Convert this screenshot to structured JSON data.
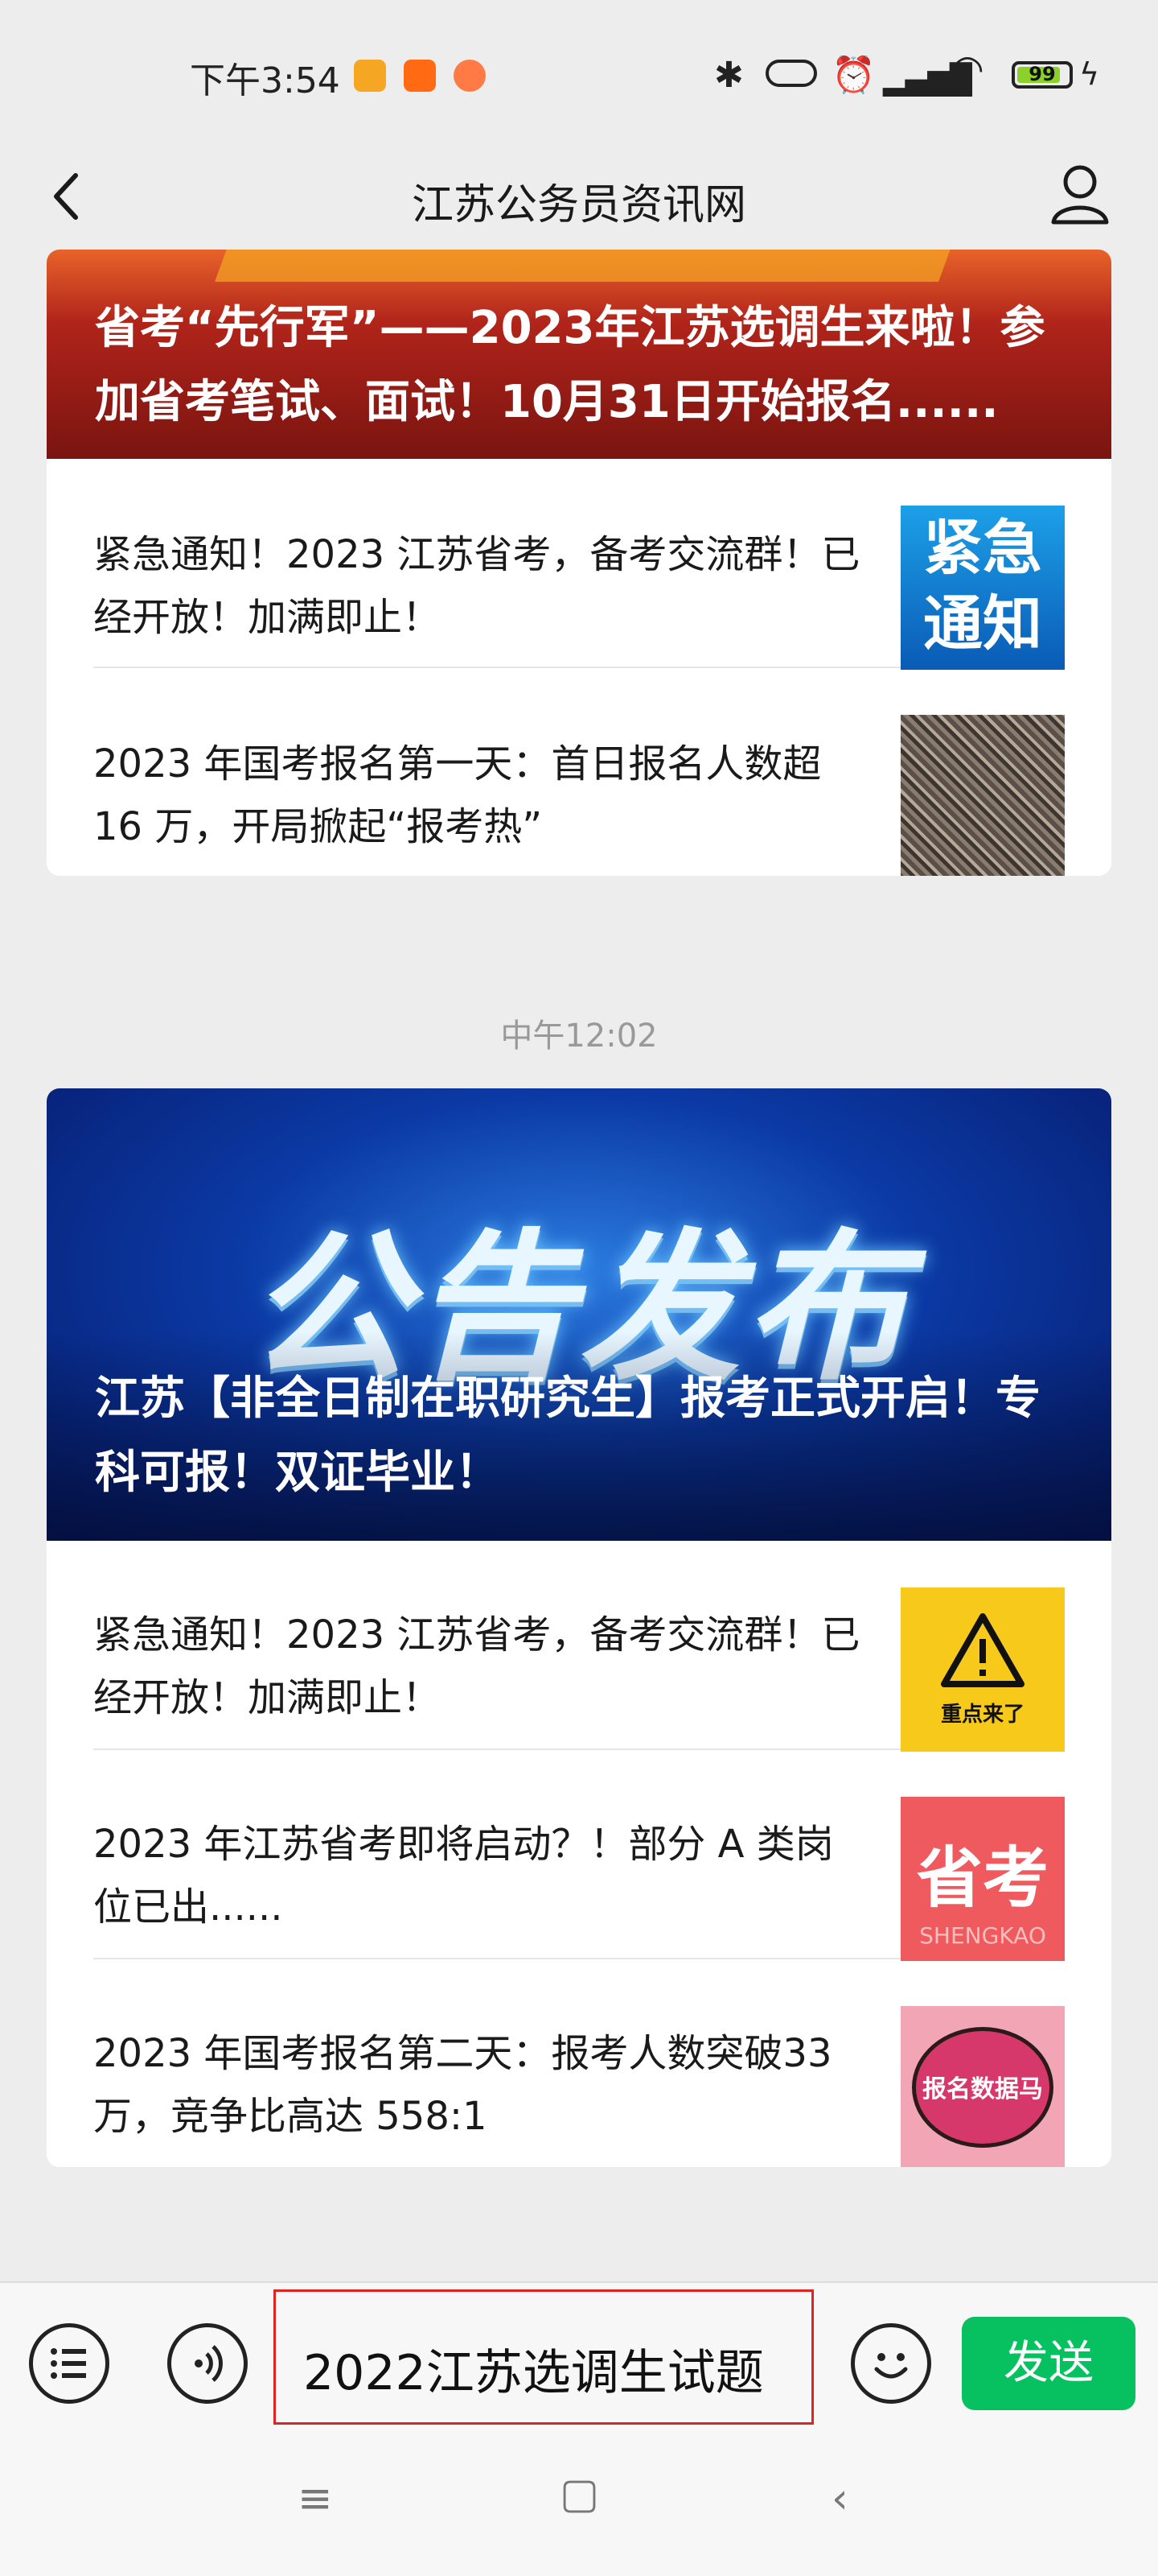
{
  "status_bar": {
    "time": "下午3:54",
    "battery": "99",
    "app_icons": [
      "notes-app-icon",
      "taobao-app-icon",
      "cat-app-icon"
    ],
    "system_icons": [
      "bluetooth-icon",
      "nfc-icon",
      "alarm-icon",
      "signal-icon",
      "wifi-icon",
      "battery-icon",
      "charging-icon"
    ]
  },
  "header": {
    "title": "江苏公务员资讯网"
  },
  "message_groups": [
    {
      "banner_title": "省考“先行军”——2023年江苏选调生来啦！参加省考笔试、面试！10月31日开始报名......",
      "items": [
        {
          "text": "紧急通知！2023 江苏省考，备考交流群！已经开放！加满即止！",
          "thumb_text": "紧急通知"
        },
        {
          "text": "2023 年国考报名第一天：首日报名人数超 16 万，开局掀起“报考热”"
        }
      ]
    },
    {
      "timestamp": "中午12:02",
      "banner_big_text": "公告发布",
      "banner_title": "江苏【非全日制在职研究生】报考正式开启！专科可报！双证毕业！",
      "items": [
        {
          "text": "紧急通知！2023 江苏省考，备考交流群！已经开放！加满即止！",
          "thumb_text": "重点来了"
        },
        {
          "text": "2023 年江苏省考即将启动？！部分 A 类岗位已出......",
          "thumb_text": "省考",
          "thumb_sub": "SHENGKAO"
        },
        {
          "text": "2023 年国考报名第二天：报考人数突破33 万，竞争比高达 558:1",
          "thumb_text": "报名数据马上看"
        }
      ]
    }
  ],
  "input_bar": {
    "value": "2022江苏选调生试题",
    "send_label": "发送"
  },
  "colors": {
    "send_button": "#07c160",
    "input_highlight": "#e02424",
    "background": "#ededed"
  }
}
